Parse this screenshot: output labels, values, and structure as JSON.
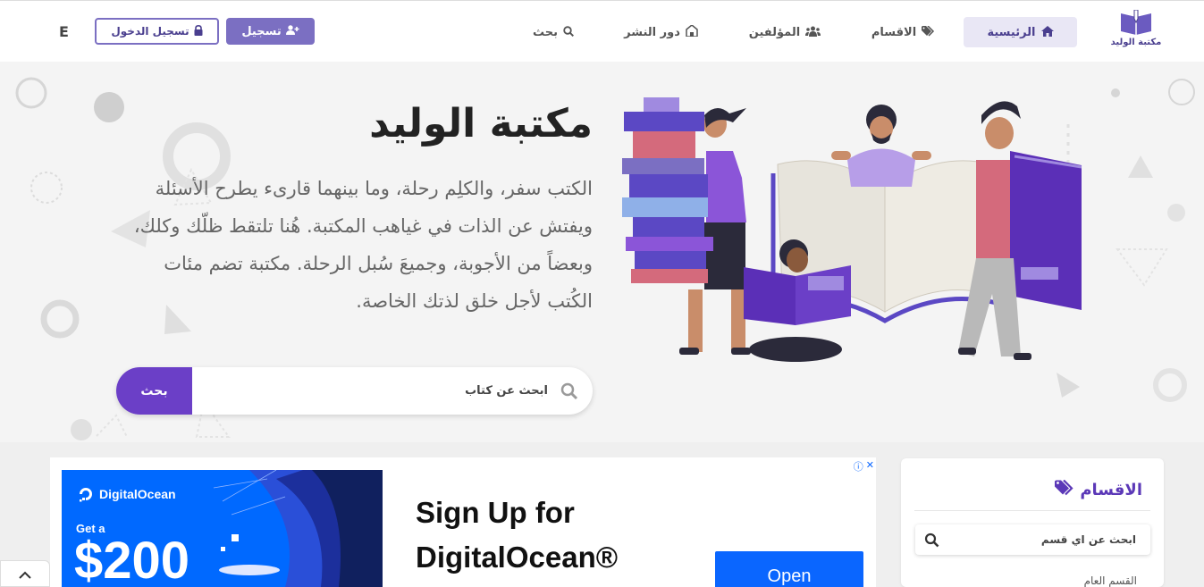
{
  "nav": {
    "logo_text": "مكتبة الوليد",
    "items": [
      {
        "label": "الرئيسية",
        "icon": "home-icon"
      },
      {
        "label": "الاقسام",
        "icon": "tags-icon"
      },
      {
        "label": "المؤلفين",
        "icon": "users-icon"
      },
      {
        "label": "دور النشر",
        "icon": "building-icon"
      },
      {
        "label": "بحث",
        "icon": "search-icon"
      }
    ],
    "signup_label": "تسجيل",
    "login_label": "تسجيل الدخول",
    "lang_label": "E"
  },
  "hero": {
    "title": "مكتبة الوليد",
    "description": "الكتب سفر، والكلِم رحلة، وما بينهما قارىء يطرح الأسئلة ويفتش عن الذات في غياهب المكتبة. هُنا تلتقط ظلّك وكلك، وبعضاً من الأجوبة، وجميعَ سُبل الرحلة. مكتبة تضم مئات الكُتب لأجل خلق لذتك الخاصة.",
    "search_placeholder": "ابحث عن كتاب",
    "search_button": "بحث"
  },
  "ad": {
    "brand": "DigitalOcean",
    "offer_prefix": "Get a",
    "offer_amount": "$200",
    "headline": "Sign Up for DigitalOcean®",
    "cta": "Open"
  },
  "sidebar": {
    "title": "الاقسام",
    "search_placeholder": "ابحث عن اي قسم",
    "first_item": "القسم العام"
  },
  "colors": {
    "brand": "#6b3fc7",
    "brand_light": "#7b6fc2",
    "nav_active_bg": "#e9e7f5",
    "ad_blue": "#0069ff"
  }
}
